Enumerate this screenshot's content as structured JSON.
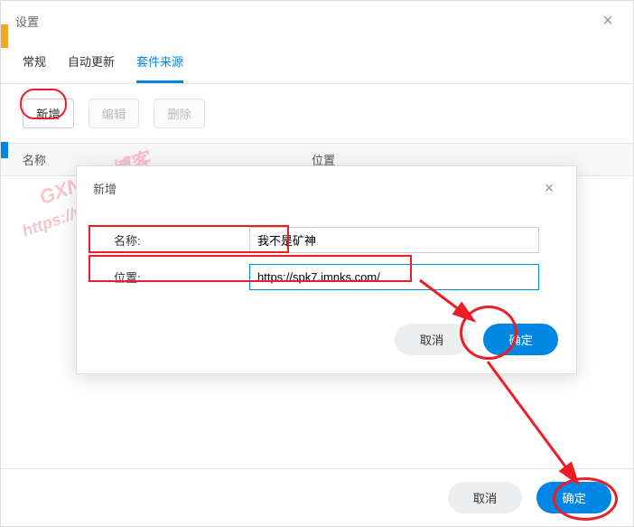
{
  "window": {
    "title": "设置",
    "close": "×"
  },
  "tabs": {
    "general": "常规",
    "autoupdate": "自动更新",
    "source": "套件来源"
  },
  "toolbar": {
    "add": "新增",
    "edit": "编辑",
    "delete": "删除"
  },
  "table": {
    "col_name": "名称",
    "col_location": "位置"
  },
  "footer": {
    "cancel": "取消",
    "confirm": "确定"
  },
  "dialog": {
    "title": "新增",
    "close": "×",
    "name_label": "名称:",
    "name_value": "我不是矿神",
    "location_label": "位置:",
    "location_value": "https://spk7.imnks.com/",
    "cancel": "取消",
    "confirm": "确定"
  },
  "watermark": {
    "line1": "GXNAS 博客",
    "line2": "https://wp.gxnas.com"
  }
}
